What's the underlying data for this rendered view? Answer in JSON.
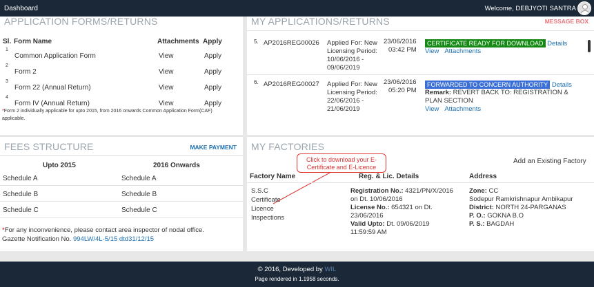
{
  "topbar": {
    "dashboard": "Dashboard",
    "welcome": "Welcome, DEBJYOTI SANTRA"
  },
  "forms": {
    "title": "APPLICATION FORMS/RETURNS",
    "headers": {
      "sl": "Sl.",
      "form": "Form Name",
      "attach": "Attachments",
      "apply": "Apply"
    },
    "rows": [
      {
        "sl": "1",
        "name": "Common Application Form",
        "view": "View",
        "apply": "Apply"
      },
      {
        "sl": "2",
        "name": "Form 2",
        "view": "View",
        "apply": "Apply"
      },
      {
        "sl": "3",
        "name": "Form 22 (Annual Return)",
        "view": "View",
        "apply": "Apply"
      },
      {
        "sl": "4",
        "name": "Form IV (Annual Return)",
        "view": "View",
        "apply": "Apply"
      }
    ],
    "note_star": "*",
    "note": "Form 2 individually applicable for upto 2015, from 2016 onwards Common Application Form(CAF) applicable."
  },
  "applications": {
    "title": "MY APPLICATIONS/RETURNS",
    "message_box": "MESSAGE BOX",
    "items": [
      {
        "sl": "5.",
        "id": "AP2016REG00026",
        "desc": [
          "Applied For: New",
          "Licensing Period:",
          "10/06/2016 -",
          "09/06/2019"
        ],
        "date": "23/06/2016",
        "time": "03:42 PM",
        "status": "CERTIFICATE READY FOR DOWNLOAD",
        "details": "Details",
        "view": "View",
        "attachments": "Attachments"
      },
      {
        "sl": "6.",
        "id": "AP2016REG00027",
        "desc": [
          "Applied For: New",
          "Licensing Period:",
          "22/06/2016 -",
          "21/06/2019"
        ],
        "date": "23/06/2016",
        "time": "05:20 PM",
        "status": "FORWARDED TO CONCERN AUTHORITY",
        "details": "Details",
        "remark_label": "Remark:",
        "remark": "REVERT BACK TO: REGISTRATION &",
        "remark2": "PLAN SECTION",
        "view": "View",
        "attachments": "Attachments"
      }
    ],
    "colors": {
      "ready": "#148a14",
      "forwarded": "#3a6fd8"
    }
  },
  "fees": {
    "title": "FEES STRUCTURE",
    "make_payment": "MAKE PAYMENT",
    "col1": "Upto 2015",
    "col2": "2016 Onwards",
    "rows": [
      [
        "Schedule A",
        "Schedule A"
      ],
      [
        "Schedule B",
        "Schedule B"
      ],
      [
        "Schedule C",
        "Schedule C"
      ]
    ],
    "star": "*",
    "note1": "For any inconvenience, please contact area inspector of nodal office.",
    "note2_prefix": "Gazette Notification No.",
    "note2_link": "994LW/4L-5/15 dtd31/12/15"
  },
  "factories": {
    "title": "MY FACTORIES",
    "callout_line1": "Click to download your E-",
    "callout_line2": "Certificate and E-Licence",
    "add": "Add an Existing Factory",
    "headers": {
      "name": "Factory Name",
      "reg": "Reg. & Lic. Details",
      "address": "Address"
    },
    "factory": {
      "name": "S.S.C",
      "links": [
        "Certificate",
        "Licence",
        "Inspections"
      ],
      "reg_label": "Registration No.:",
      "reg_no": "4321/PN/X/2016",
      "reg_dt": "on Dt. 10/06/2016",
      "lic_label": "License No.:",
      "lic_no": "654321 on Dt.",
      "lic_dt": "23/06/2016",
      "valid_label": "Valid Upto:",
      "valid": "Dt. 09/06/2019",
      "valid_time": "11:59:59 AM",
      "zone_label": "Zone:",
      "zone": "CC",
      "addr": "Sodepur Ramkrishnapur Ambikapur",
      "district_label": "District:",
      "district": "NORTH 24-PARGANAS",
      "po_label": "P. O.:",
      "po": "GOKNA B.O",
      "ps_label": "P. S.:",
      "ps": "BAGDAH"
    }
  },
  "footer": {
    "line1_prefix": "© 2016, Developed by",
    "brand": "WIL",
    "line2": "Page rendered in 1.1958 seconds."
  }
}
